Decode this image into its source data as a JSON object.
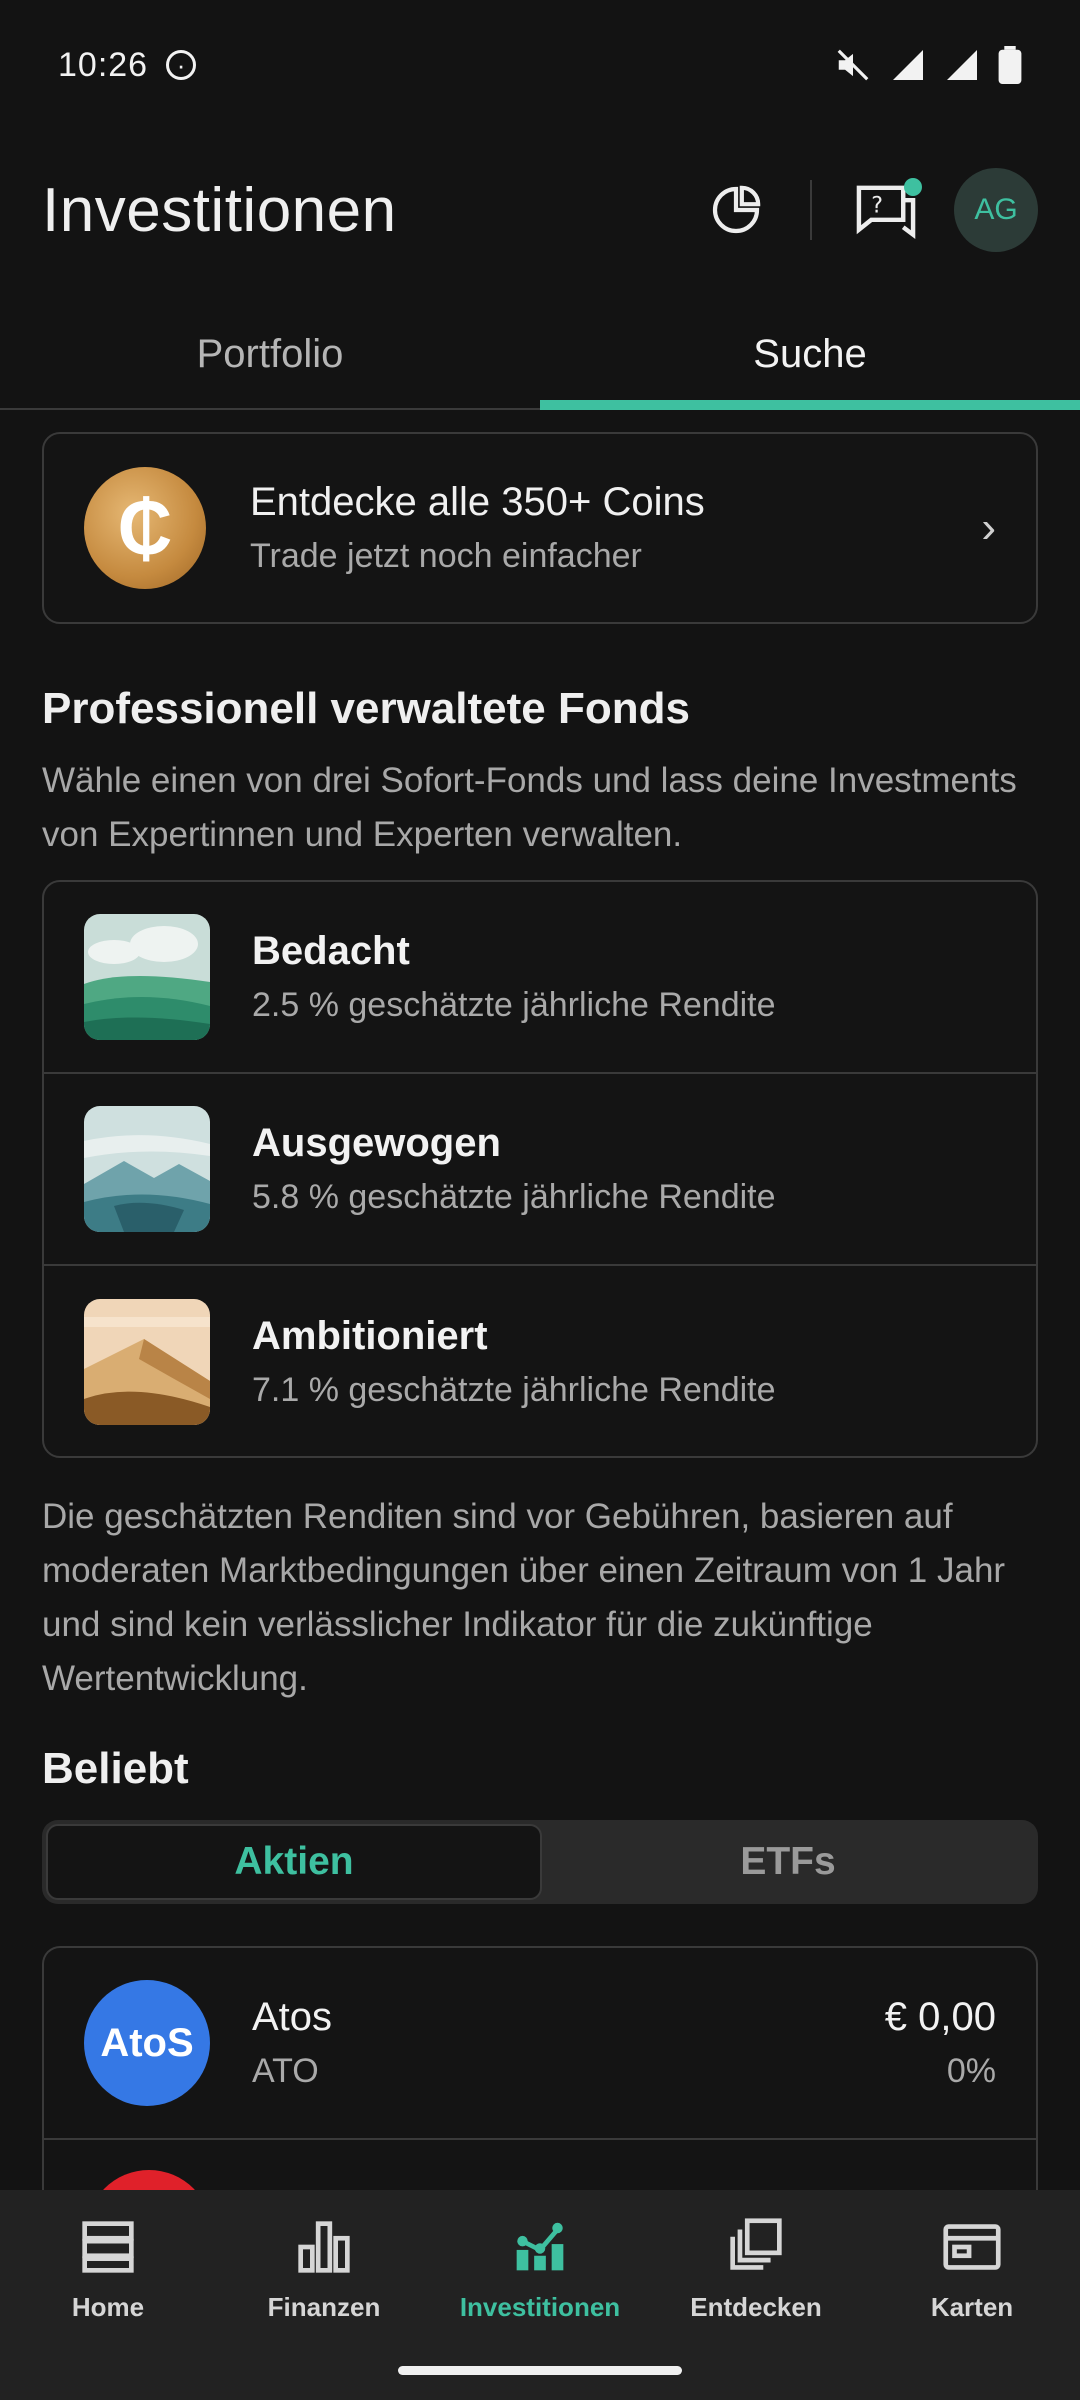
{
  "status_bar": {
    "time": "10:26"
  },
  "header": {
    "title": "Investitionen",
    "avatar_initials": "AG"
  },
  "tabs": [
    {
      "label": "Portfolio",
      "active": false
    },
    {
      "label": "Suche",
      "active": true
    }
  ],
  "promo": {
    "title": "Entdecke alle 350+ Coins",
    "subtitle": "Trade jetzt noch einfacher"
  },
  "funds_section": {
    "title": "Professionell verwaltete Fonds",
    "description": "Wähle einen von drei Sofort-Fonds und lass deine Investments von Expertinnen und Experten verwalten.",
    "items": [
      {
        "name": "Bedacht",
        "subtitle": "2.5 % geschätzte jährliche Rendite"
      },
      {
        "name": "Ausgewogen",
        "subtitle": "5.8 % geschätzte jährliche Rendite"
      },
      {
        "name": "Ambitioniert",
        "subtitle": "7.1 % geschätzte jährliche Rendite"
      }
    ],
    "disclaimer": "Die geschätzten Renditen sind vor Gebühren, basieren auf moderaten Marktbedingungen über einen Zeitraum von 1 Jahr und sind kein verlässlicher Indikator für die zukünftige Wertentwicklung."
  },
  "popular": {
    "title": "Beliebt",
    "segments": [
      {
        "label": "Aktien",
        "active": true
      },
      {
        "label": "ETFs",
        "active": false
      }
    ],
    "stocks": [
      {
        "logo_text": "AtoS",
        "name": "Atos",
        "ticker": "ATO",
        "price": "€ 0,00",
        "change": "0%"
      }
    ]
  },
  "bottom_nav": [
    {
      "label": "Home",
      "icon": "home-icon",
      "active": false
    },
    {
      "label": "Finanzen",
      "icon": "bar-chart-icon",
      "active": false
    },
    {
      "label": "Investitionen",
      "icon": "investments-icon",
      "active": true
    },
    {
      "label": "Entdecken",
      "icon": "discover-icon",
      "active": false
    },
    {
      "label": "Karten",
      "icon": "card-icon",
      "active": false
    }
  ],
  "colors": {
    "accent": "#3ec0a0",
    "background": "#131313"
  }
}
